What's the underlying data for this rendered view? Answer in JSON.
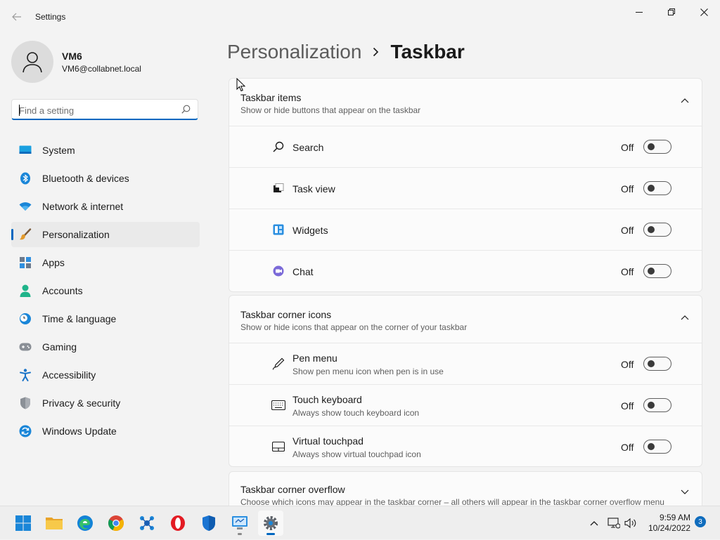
{
  "window": {
    "title": "Settings"
  },
  "profile": {
    "name": "VM6",
    "email": "VM6@collabnet.local"
  },
  "search": {
    "placeholder": "Find a setting",
    "value": ""
  },
  "nav": {
    "items": [
      {
        "label": "System",
        "icon": "monitor-icon",
        "active": false
      },
      {
        "label": "Bluetooth & devices",
        "icon": "bluetooth-icon",
        "active": false
      },
      {
        "label": "Network & internet",
        "icon": "wifi-icon",
        "active": false
      },
      {
        "label": "Personalization",
        "icon": "paintbrush-icon",
        "active": true
      },
      {
        "label": "Apps",
        "icon": "apps-icon",
        "active": false
      },
      {
        "label": "Accounts",
        "icon": "person-icon",
        "active": false
      },
      {
        "label": "Time & language",
        "icon": "clock-globe-icon",
        "active": false
      },
      {
        "label": "Gaming",
        "icon": "gamepad-icon",
        "active": false
      },
      {
        "label": "Accessibility",
        "icon": "accessibility-icon",
        "active": false
      },
      {
        "label": "Privacy & security",
        "icon": "shield-icon",
        "active": false
      },
      {
        "label": "Windows Update",
        "icon": "update-icon",
        "active": false
      }
    ]
  },
  "breadcrumb": {
    "parent": "Personalization",
    "current": "Taskbar"
  },
  "sections": {
    "taskbar_items": {
      "title": "Taskbar items",
      "subtitle": "Show or hide buttons that appear on the taskbar",
      "rows": [
        {
          "label": "Search",
          "state": "Off",
          "icon": "search-icon"
        },
        {
          "label": "Task view",
          "state": "Off",
          "icon": "task-view-icon"
        },
        {
          "label": "Widgets",
          "state": "Off",
          "icon": "widgets-icon"
        },
        {
          "label": "Chat",
          "state": "Off",
          "icon": "chat-icon"
        }
      ]
    },
    "corner_icons": {
      "title": "Taskbar corner icons",
      "subtitle": "Show or hide icons that appear on the corner of your taskbar",
      "rows": [
        {
          "label": "Pen menu",
          "desc": "Show pen menu icon when pen is in use",
          "state": "Off",
          "icon": "pen-icon"
        },
        {
          "label": "Touch keyboard",
          "desc": "Always show touch keyboard icon",
          "state": "Off",
          "icon": "keyboard-icon"
        },
        {
          "label": "Virtual touchpad",
          "desc": "Always show virtual touchpad icon",
          "state": "Off",
          "icon": "touchpad-icon"
        }
      ]
    },
    "corner_overflow": {
      "title": "Taskbar corner overflow",
      "subtitle": "Choose which icons may appear in the taskbar corner – all others will appear in the taskbar corner overflow menu"
    }
  },
  "taskbar": {
    "apps": [
      {
        "name": "start",
        "icon": "windows-logo-icon"
      },
      {
        "name": "file-explorer",
        "icon": "folder-icon"
      },
      {
        "name": "edge",
        "icon": "edge-icon"
      },
      {
        "name": "chrome",
        "icon": "chrome-icon"
      },
      {
        "name": "app-network",
        "icon": "network-app-icon"
      },
      {
        "name": "opera",
        "icon": "opera-icon"
      },
      {
        "name": "defender",
        "icon": "defender-shield-icon"
      },
      {
        "name": "remote-desktop",
        "icon": "remote-desktop-icon"
      },
      {
        "name": "settings",
        "icon": "settings-gear-icon"
      }
    ],
    "time": "9:59 AM",
    "date": "10/24/2022",
    "notification_count": "3"
  },
  "colors": {
    "accent": "#0067c0",
    "background": "#f3f3f3",
    "card": "#fbfbfb"
  }
}
